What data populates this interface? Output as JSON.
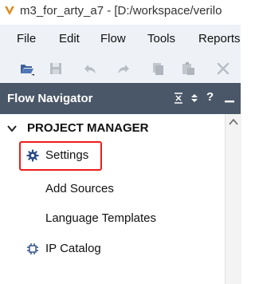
{
  "window": {
    "title": "m3_for_arty_a7 - [D:/workspace/verilo"
  },
  "menu": {
    "items": [
      "File",
      "Edit",
      "Flow",
      "Tools",
      "Reports"
    ]
  },
  "toolbar": {
    "buttons": [
      "open-project-icon",
      "save-icon",
      "undo-icon",
      "redo-icon",
      "copy-icon",
      "paste-icon",
      "delete-icon"
    ]
  },
  "flow_navigator": {
    "title": "Flow Navigator",
    "controls": [
      "collapse-all-icon",
      "expand-all-icon",
      "help-icon",
      "minimize-icon"
    ],
    "help_glyph": "?",
    "section": {
      "label": "PROJECT MANAGER",
      "items": [
        {
          "label": "Settings",
          "icon": "gear-icon",
          "highlighted": true
        },
        {
          "label": "Add Sources"
        },
        {
          "label": "Language Templates"
        },
        {
          "label": "IP Catalog",
          "icon": "ip-catalog-icon"
        }
      ]
    }
  },
  "colors": {
    "nav_header_bg": "#4a5768",
    "menu_bg": "#eef1f6",
    "highlight_border": "#ee1c1c",
    "gear_icon": "#2d4d8a"
  }
}
